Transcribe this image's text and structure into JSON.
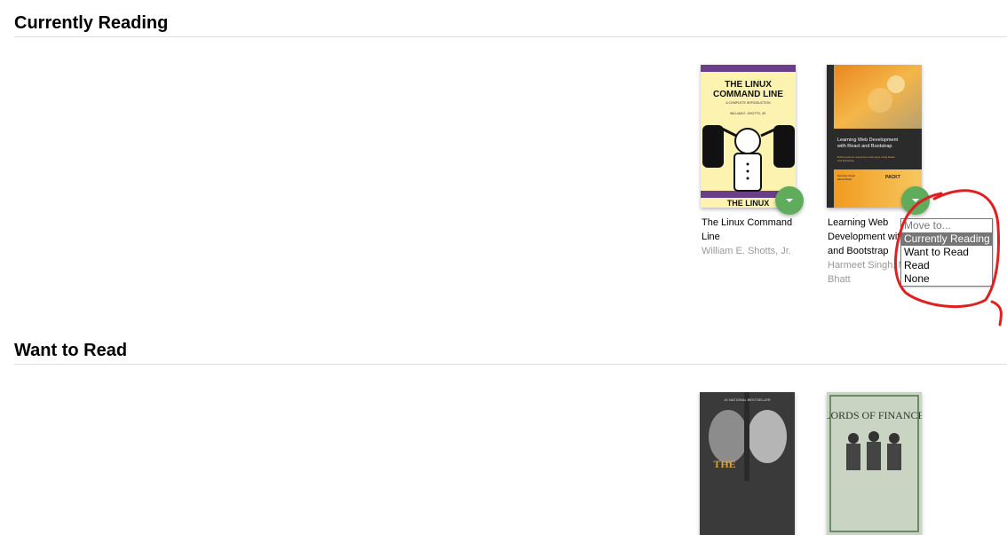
{
  "shelves": [
    {
      "title": "Currently Reading"
    },
    {
      "title": "Want to Read"
    }
  ],
  "books": {
    "linux": {
      "cover_top": "THE LINUX",
      "cover_bottom": "COMMAND LINE",
      "cover_tagline": "A COMPLETE INTRODUCTION",
      "cover_author": "WILLIAM E. SHOTTS, JR.",
      "cover_footer": "THE LINUX",
      "title_line1": "The Linux Command",
      "title_line2": "Line",
      "author": "William E. Shotts, Jr."
    },
    "react": {
      "cover_title_l1": "Learning Web Development",
      "cover_title_l2": "with React and Bootstrap",
      "cover_sub_l1": "Build real-time responsive web apps using React",
      "cover_sub_l2": "and Bootstrap",
      "cover_authors_l1": "Harmeet Singh",
      "cover_authors_l2": "Mehul Bhatt",
      "cover_publisher": "PACKT",
      "title_line1": "Learning Web",
      "title_line2": "Development with",
      "title_line3": "and Bootstrap",
      "author_line1": "Harmeet Singh, M",
      "author_line2": "Bhatt"
    },
    "nightingale": {
      "cover_top": "#1 NATIONAL BESTSELLER",
      "cover_title": "THE"
    },
    "finance": {
      "cover_title": "LORDS OF FINANCE"
    }
  },
  "dropdown": {
    "options": [
      "Move to...",
      "Currently Reading",
      "Want to Read",
      "Read",
      "None"
    ],
    "selected": "Currently Reading"
  },
  "colors": {
    "changer": "#60ac5d",
    "annotation": "#e02020"
  },
  "icons": {
    "changer": "caret-down-icon"
  }
}
